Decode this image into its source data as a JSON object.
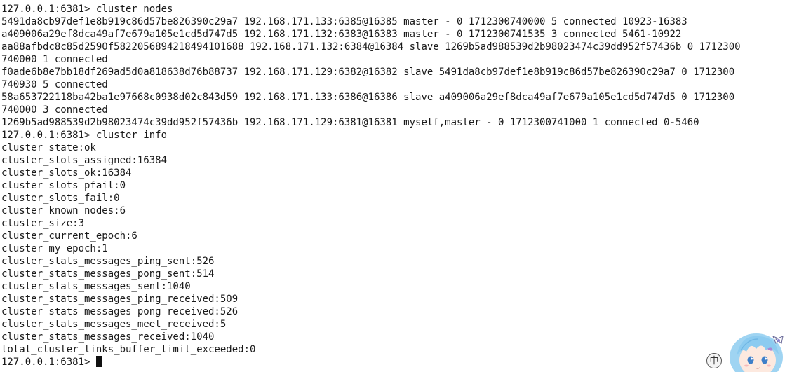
{
  "terminal": {
    "lines": [
      "127.0.0.1:6381> cluster nodes",
      "5491da8cb97def1e8b919c86d57be826390c29a7 192.168.171.133:6385@16385 master - 0 1712300740000 5 connected 10923-16383",
      "a409006a29ef8dca49af7e679a105e1cd5d747d5 192.168.171.132:6383@16383 master - 0 1712300741535 3 connected 5461-10922",
      "aa88afbdc8c85d2590f5822056894218494101688 192.168.171.132:6384@16384 slave 1269b5ad988539d2b98023474c39dd952f57436b 0 1712300",
      "740000 1 connected",
      "f0ade6b8e7bb18df269ad5d0a818638d76b88737 192.168.171.129:6382@16382 slave 5491da8cb97def1e8b919c86d57be826390c29a7 0 1712300",
      "740930 5 connected",
      "58a653722118ba42ba1e97668c0938d02c843d59 192.168.171.133:6386@16386 slave a409006a29ef8dca49af7e679a105e1cd5d747d5 0 1712300",
      "740000 3 connected",
      "1269b5ad988539d2b98023474c39dd952f57436b 192.168.171.129:6381@16381 myself,master - 0 1712300741000 1 connected 0-5460",
      "127.0.0.1:6381> cluster info",
      "cluster_state:ok",
      "cluster_slots_assigned:16384",
      "cluster_slots_ok:16384",
      "cluster_slots_pfail:0",
      "cluster_slots_fail:0",
      "cluster_known_nodes:6",
      "cluster_size:3",
      "cluster_current_epoch:6",
      "cluster_my_epoch:1",
      "cluster_stats_messages_ping_sent:526",
      "cluster_stats_messages_pong_sent:514",
      "cluster_stats_messages_sent:1040",
      "cluster_stats_messages_ping_received:509",
      "cluster_stats_messages_pong_received:526",
      "cluster_stats_messages_meet_received:5",
      "cluster_stats_messages_received:1040",
      "total_cluster_links_buffer_limit_exceeded:0"
    ],
    "prompt": "127.0.0.1:6381> ",
    "colors": {
      "background": "#ffffff",
      "text": "#1a1a1a",
      "cursor": "#111111"
    }
  },
  "tray": {
    "ime_label": "中",
    "mascot_icon": "anime-mascot-icon"
  }
}
